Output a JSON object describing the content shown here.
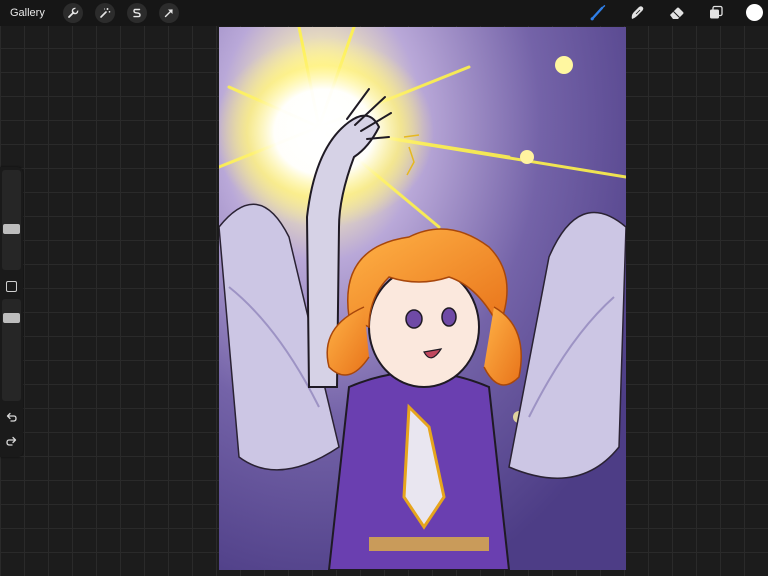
{
  "topbar": {
    "gallery_label": "Gallery",
    "left_tools": [
      {
        "icon": "wrench-icon",
        "name": "actions"
      },
      {
        "icon": "magic-wand-icon",
        "name": "adjustments"
      },
      {
        "icon": "selection-s-icon",
        "name": "selection"
      },
      {
        "icon": "arrow-cursor-icon",
        "name": "transform"
      }
    ],
    "right_tools": [
      {
        "icon": "brush-icon",
        "name": "brush",
        "active": true
      },
      {
        "icon": "smudge-icon",
        "name": "smudge",
        "active": false
      },
      {
        "icon": "eraser-icon",
        "name": "eraser",
        "active": false
      },
      {
        "icon": "layers-icon",
        "name": "layers",
        "active": false
      }
    ],
    "current_color": "#ffffff",
    "active_color": "#2f7fe8"
  },
  "sidebar": {
    "brush_size_level": 0.4,
    "opacity_level": 0.85,
    "modify_icon": "square-outline-icon",
    "undo_icon": "undo-icon",
    "redo_icon": "redo-icon"
  },
  "canvas": {
    "content": "artwork"
  }
}
